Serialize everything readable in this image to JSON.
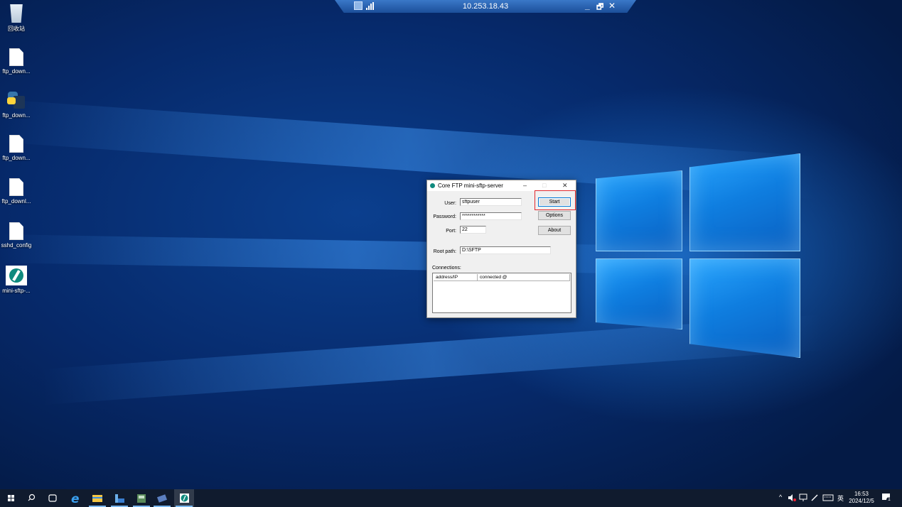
{
  "remote_bar": {
    "title": "10.253.18.43",
    "minimize": "_",
    "restore": "🗗",
    "close": "✕"
  },
  "desktop_icons": [
    {
      "label": "回收站",
      "icon": "recycle-bin-icon"
    },
    {
      "label": "ftp_down...",
      "icon": "file-icon"
    },
    {
      "label": "ftp_down...",
      "icon": "python-script-icon"
    },
    {
      "label": "ftp_down...",
      "icon": "file-icon"
    },
    {
      "label": "ftp_downl...",
      "icon": "file-icon"
    },
    {
      "label": "sshd_config",
      "icon": "file-icon"
    },
    {
      "label": "mini-sftp-...",
      "icon": "mini-sftp-server-icon"
    }
  ],
  "window": {
    "title": "Core FTP mini-sftp-server",
    "controls": {
      "minimize": "–",
      "maximize": "□",
      "close": "✕"
    },
    "user_label": "User:",
    "user_value": "sftpuser",
    "password_label": "Password:",
    "password_value": "************",
    "port_label": "Port:",
    "port_value": "22",
    "root_label": "Root path:",
    "root_value": "D:\\SFTP",
    "buttons": {
      "start": "Start",
      "options": "Options",
      "about": "About"
    },
    "connections_label": "Connections:",
    "columns": [
      "address/IP",
      "connected @"
    ],
    "accent": "#0f8a7e"
  },
  "taskbar": {
    "tray": {
      "chevron": "^",
      "ime": "英",
      "time": "16:53",
      "date": "2024/12/5",
      "notification_count": "1"
    }
  }
}
